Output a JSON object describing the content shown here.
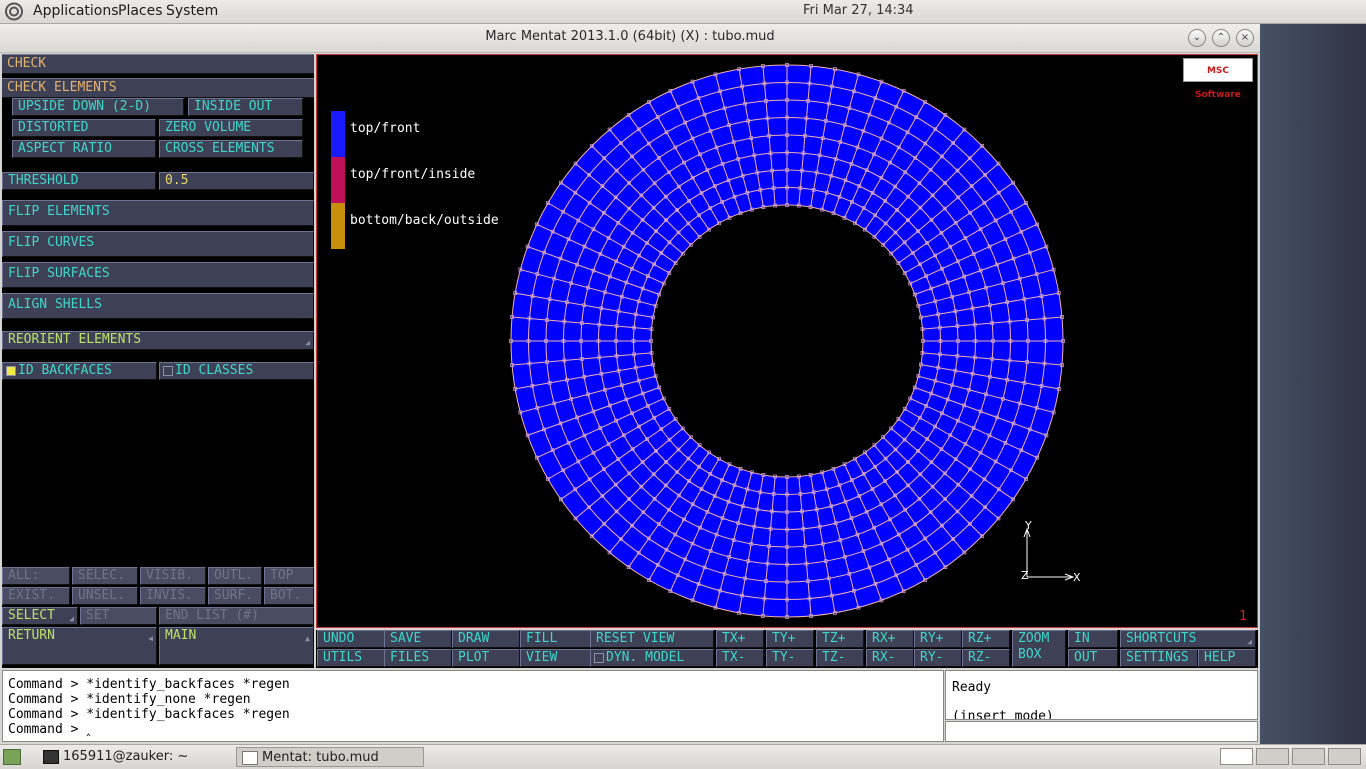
{
  "top_panel": {
    "menus": [
      "Applications",
      "Places",
      "System"
    ],
    "clock": "Fri Mar 27, 14:34"
  },
  "window": {
    "title": "Marc Mentat 2013.1.0 (64bit) (X) : tubo.mud",
    "buttons": [
      "minimize",
      "maximize",
      "close"
    ]
  },
  "left_panel": {
    "header": "CHECK",
    "check_elements_header": "CHECK ELEMENTS",
    "check_buttons": [
      "UPSIDE DOWN (2-D)",
      "INSIDE OUT",
      "DISTORTED",
      "ZERO VOLUME",
      "ASPECT RATIO",
      "CROSS ELEMENTS"
    ],
    "threshold_label": "THRESHOLD",
    "threshold_value": "0.5",
    "flip_buttons": [
      "FLIP ELEMENTS",
      "FLIP CURVES",
      "FLIP SURFACES",
      "ALIGN SHELLS"
    ],
    "reorient": "REORIENT ELEMENTS",
    "id_backfaces": "ID BACKFACES",
    "id_backfaces_checked": true,
    "id_classes": "ID CLASSES",
    "id_classes_checked": false,
    "selection_row1": [
      "ALL:",
      "SELEC.",
      "VISIB.",
      "OUTL.",
      "TOP"
    ],
    "selection_row2": [
      "EXIST.",
      "UNSEL.",
      "INVIS.",
      "SURF.",
      "BOT."
    ],
    "select": "SELECT",
    "set": "SET",
    "end_list": "END LIST (#)",
    "return": "RETURN",
    "main": "MAIN"
  },
  "graphics": {
    "legend": [
      {
        "label": "top/front",
        "color": "#1a1aff"
      },
      {
        "label": "top/front/inside",
        "color": "#c0105a"
      },
      {
        "label": "bottom/back/outside",
        "color": "#c8900a"
      }
    ],
    "logo": "MSC Software",
    "viewport_number": "1",
    "mesh_fill": "#0000ff",
    "mesh_line": "#f0b0b0",
    "node_color": "#c49ad0",
    "axis_x": "X",
    "axis_y": "Y",
    "axis_z": "Z"
  },
  "toolbar": {
    "row1": [
      "UNDO",
      "SAVE",
      "DRAW",
      "FILL",
      "RESET VIEW",
      "TX+",
      "TY+",
      "TZ+",
      "RX+",
      "RY+",
      "RZ+",
      "ZOOM",
      "IN",
      "SHORTCUTS"
    ],
    "row2": [
      "UTILS",
      "FILES",
      "PLOT",
      "VIEW",
      "DYN. MODEL",
      "TX-",
      "TY-",
      "TZ-",
      "RX-",
      "RY-",
      "RZ-",
      "BOX",
      "OUT",
      "SETTINGS",
      "HELP"
    ]
  },
  "command": {
    "lines": [
      "Command > *identify_backfaces *regen",
      "Command > *identify_none *regen",
      "Command > *identify_backfaces *regen",
      "Command > "
    ],
    "status": "Ready",
    "mode": "(insert mode)"
  },
  "taskbar": {
    "tasks": [
      "165911@zauker: ~",
      "Mentat: tubo.mud"
    ]
  }
}
